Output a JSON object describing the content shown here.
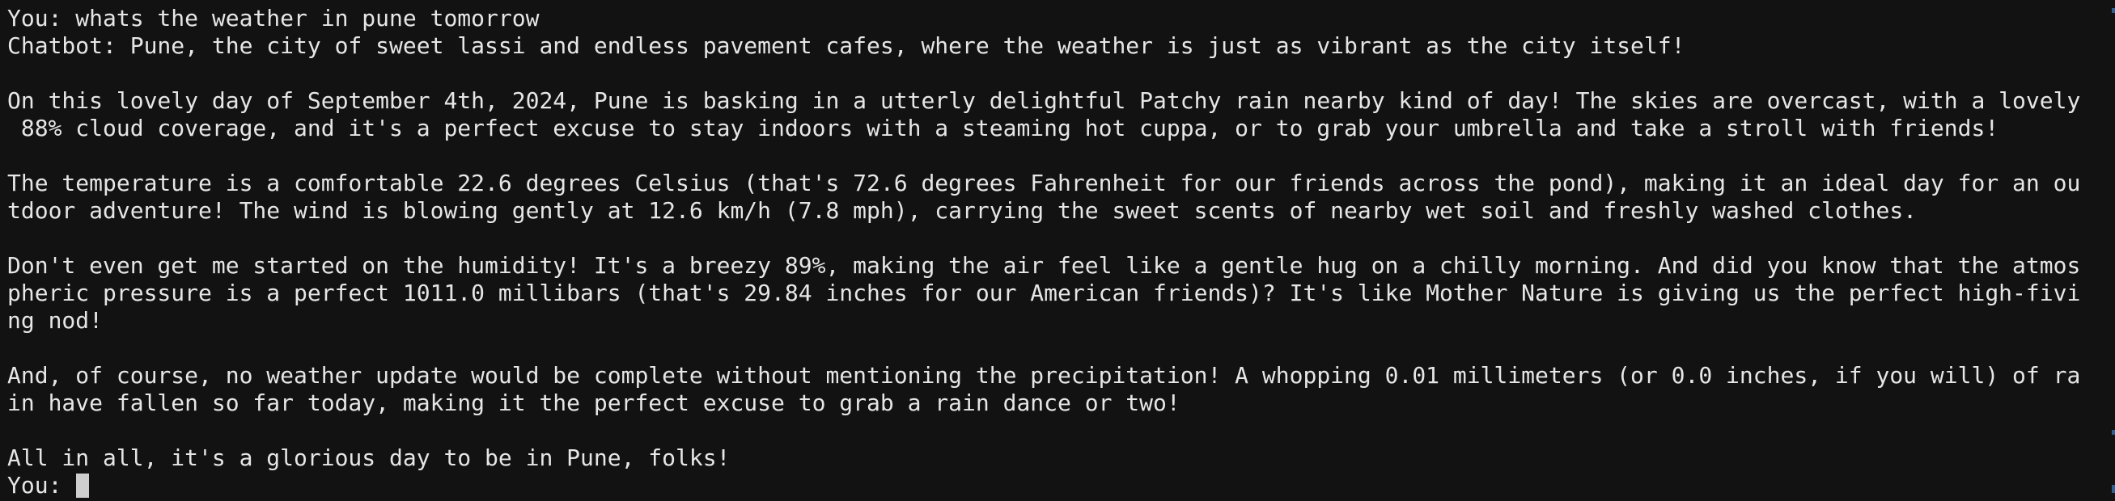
{
  "terminal": {
    "lines": [
      "You: whats the weather in pune tomorrow",
      "Chatbot: Pune, the city of sweet lassi and endless pavement cafes, where the weather is just as vibrant as the city itself!",
      "",
      "On this lovely day of September 4th, 2024, Pune is basking in a utterly delightful Patchy rain nearby kind of day! The skies are overcast, with a lovely",
      " 88% cloud coverage, and it's a perfect excuse to stay indoors with a steaming hot cuppa, or to grab your umbrella and take a stroll with friends!",
      "",
      "The temperature is a comfortable 22.6 degrees Celsius (that's 72.6 degrees Fahrenheit for our friends across the pond), making it an ideal day for an ou",
      "tdoor adventure! The wind is blowing gently at 12.6 km/h (7.8 mph), carrying the sweet scents of nearby wet soil and freshly washed clothes.",
      "",
      "Don't even get me started on the humidity! It's a breezy 89%, making the air feel like a gentle hug on a chilly morning. And did you know that the atmos",
      "pheric pressure is a perfect 1011.0 millibars (that's 29.84 inches for our American friends)? It's like Mother Nature is giving us the perfect high-fivi",
      "ng nod!",
      "",
      "And, of course, no weather update would be complete without mentioning the precipitation! A whopping 0.01 millimeters (or 0.0 inches, if you will) of ra",
      "in have fallen so far today, making it the perfect excuse to grab a rain dance or two!",
      "",
      "All in all, it's a glorious day to be in Pune, folks!"
    ],
    "prompt": "You: ",
    "colors": {
      "background": "#121212",
      "text": "#e6e6e6",
      "cursor": "#cfcfcf",
      "scroll_marker": "#2f5f8f"
    }
  }
}
